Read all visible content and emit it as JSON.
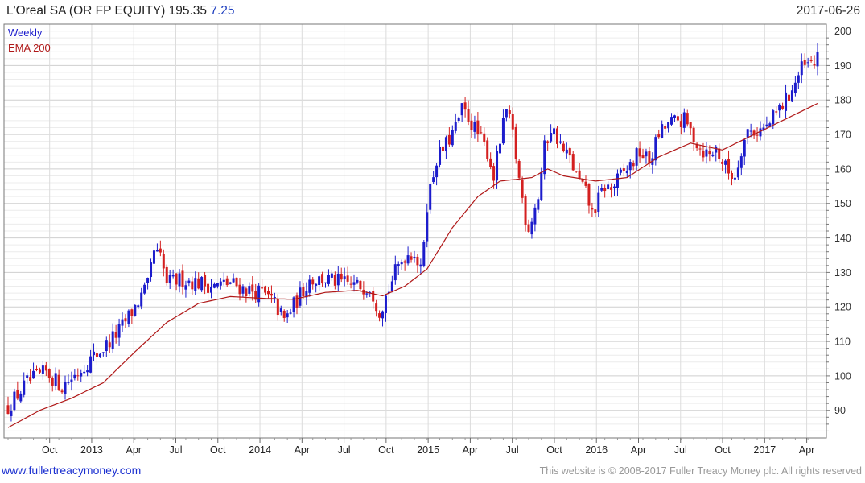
{
  "header": {
    "title": "L'Oreal SA (OR FP EQUITY) 195.35",
    "change": "7.25",
    "date": "2017-06-26"
  },
  "footer": {
    "site": "www.fullertreacymoney.com",
    "copyright": "This website is © 2008-2017 Fuller Treacy Money plc. All rights reserved"
  },
  "colors": {
    "up": "#1c1ccc",
    "down": "#d42020",
    "ema": "#b01818",
    "grid": "#dcdcdc",
    "legend_weekly": "#1c1ccc",
    "legend_ema": "#b01818"
  },
  "chart_data": {
    "type": "candlestick",
    "legend": [
      "Weekly",
      "EMA 200"
    ],
    "legend_placement": "top-left",
    "x_ticks": [
      "Oct",
      "2013",
      "Apr",
      "Jul",
      "Oct",
      "2014",
      "Apr",
      "Jul",
      "Oct",
      "2015",
      "Apr",
      "Jul",
      "Oct",
      "2016",
      "Apr",
      "Jul",
      "Oct",
      "2017",
      "Apr"
    ],
    "y_ticks": [
      90,
      100,
      110,
      120,
      130,
      140,
      150,
      160,
      170,
      180,
      190,
      200
    ],
    "ylim": [
      82,
      202
    ],
    "y_axis_side": "right",
    "grid": true,
    "price_anchors": [
      [
        0,
        91
      ],
      [
        6,
        98
      ],
      [
        12,
        101
      ],
      [
        17,
        97
      ],
      [
        22,
        101
      ],
      [
        25,
        104
      ],
      [
        30,
        108
      ],
      [
        35,
        113
      ],
      [
        40,
        120
      ],
      [
        44,
        126
      ],
      [
        46,
        136
      ],
      [
        48,
        134
      ],
      [
        50,
        127
      ],
      [
        55,
        128
      ],
      [
        60,
        127
      ],
      [
        65,
        126
      ],
      [
        70,
        127
      ],
      [
        75,
        125
      ],
      [
        80,
        124
      ],
      [
        84,
        121
      ],
      [
        87,
        116
      ],
      [
        91,
        122
      ],
      [
        95,
        128
      ],
      [
        100,
        128
      ],
      [
        105,
        127
      ],
      [
        110,
        126
      ],
      [
        114,
        126
      ],
      [
        117,
        119
      ],
      [
        119,
        123
      ],
      [
        122,
        130
      ],
      [
        125,
        135
      ],
      [
        128,
        136
      ],
      [
        130,
        130
      ],
      [
        132,
        150
      ],
      [
        135,
        163
      ],
      [
        138,
        167
      ],
      [
        141,
        172
      ],
      [
        143,
        177
      ],
      [
        145,
        175
      ],
      [
        148,
        170
      ],
      [
        151,
        165
      ],
      [
        153,
        158
      ],
      [
        155,
        168
      ],
      [
        157,
        177
      ],
      [
        159,
        170
      ],
      [
        161,
        157
      ],
      [
        163,
        146
      ],
      [
        164,
        143
      ],
      [
        165,
        146
      ],
      [
        167,
        152
      ],
      [
        169,
        166
      ],
      [
        171,
        172
      ],
      [
        173,
        169
      ],
      [
        175,
        165
      ],
      [
        177,
        163
      ],
      [
        179,
        158
      ],
      [
        182,
        153
      ],
      [
        184,
        147
      ],
      [
        186,
        151
      ],
      [
        188,
        155
      ],
      [
        190,
        154
      ],
      [
        193,
        158
      ],
      [
        196,
        161
      ],
      [
        199,
        165
      ],
      [
        202,
        162
      ],
      [
        205,
        170
      ],
      [
        208,
        173
      ],
      [
        211,
        174
      ],
      [
        213,
        174
      ],
      [
        215,
        171
      ],
      [
        218,
        166
      ],
      [
        221,
        164
      ],
      [
        223,
        166
      ],
      [
        225,
        162
      ],
      [
        227,
        159
      ],
      [
        229,
        158
      ],
      [
        231,
        166
      ],
      [
        233,
        171
      ],
      [
        236,
        171
      ],
      [
        239,
        172
      ],
      [
        242,
        176
      ],
      [
        245,
        180
      ],
      [
        248,
        185
      ],
      [
        250,
        189
      ],
      [
        252,
        190
      ],
      [
        254,
        190
      ],
      [
        255,
        195
      ]
    ],
    "ema_anchors": [
      [
        0,
        85
      ],
      [
        10,
        90
      ],
      [
        20,
        93.5
      ],
      [
        30,
        98
      ],
      [
        40,
        107
      ],
      [
        50,
        115.5
      ],
      [
        60,
        121
      ],
      [
        70,
        123
      ],
      [
        80,
        122.5
      ],
      [
        90,
        122.2
      ],
      [
        100,
        124.2
      ],
      [
        110,
        124.8
      ],
      [
        118,
        123.2
      ],
      [
        125,
        126
      ],
      [
        132,
        131
      ],
      [
        140,
        143
      ],
      [
        148,
        152
      ],
      [
        155,
        156.5
      ],
      [
        165,
        157.5
      ],
      [
        170,
        160
      ],
      [
        175,
        158
      ],
      [
        185,
        156.5
      ],
      [
        195,
        157.5
      ],
      [
        205,
        163.5
      ],
      [
        215,
        167.5
      ],
      [
        225,
        165.5
      ],
      [
        235,
        170
      ],
      [
        245,
        174.5
      ],
      [
        255,
        179
      ]
    ]
  }
}
